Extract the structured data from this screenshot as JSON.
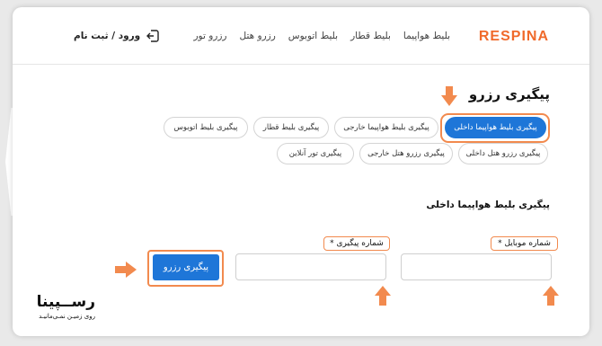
{
  "header": {
    "brand": "RESPINA",
    "nav": [
      "بلیط هواپیما",
      "بلیط قطار",
      "بلیط اتوبوس",
      "رزرو هتل",
      "رزرو تور"
    ],
    "login_label": "ورود / ثبت نام",
    "login_icon": "login-icon"
  },
  "page_title": "پیگیری رزرو",
  "tabs_row1": [
    "پیگیری بلیط هواپیما داخلی",
    "پیگیری بلیط هواپیما خارجی",
    "پیگیری بلیط قطار",
    "پیگیری بلیط اتوبوس"
  ],
  "tabs_row2": [
    "پیگیری رزرو هتل داخلی",
    "پیگیری رزرو هتل خارجی",
    "پیگیری تور آنلاین"
  ],
  "active_tab_index": 0,
  "section_title": "پیگیری بلیط هواپیما داخلی",
  "form": {
    "mobile_label": "شماره موبایل *",
    "mobile_value": "",
    "tracking_label": "شماره پیگیری *",
    "tracking_value": "",
    "submit_label": "پیگیری رزرو"
  },
  "watermark": {
    "main": "رســپینا",
    "sub": "روی زمیـن نمـی‌مانیـد"
  },
  "colors": {
    "accent": "#1e76d8",
    "highlight": "#f28a4e",
    "brand": "#f06a2b"
  }
}
